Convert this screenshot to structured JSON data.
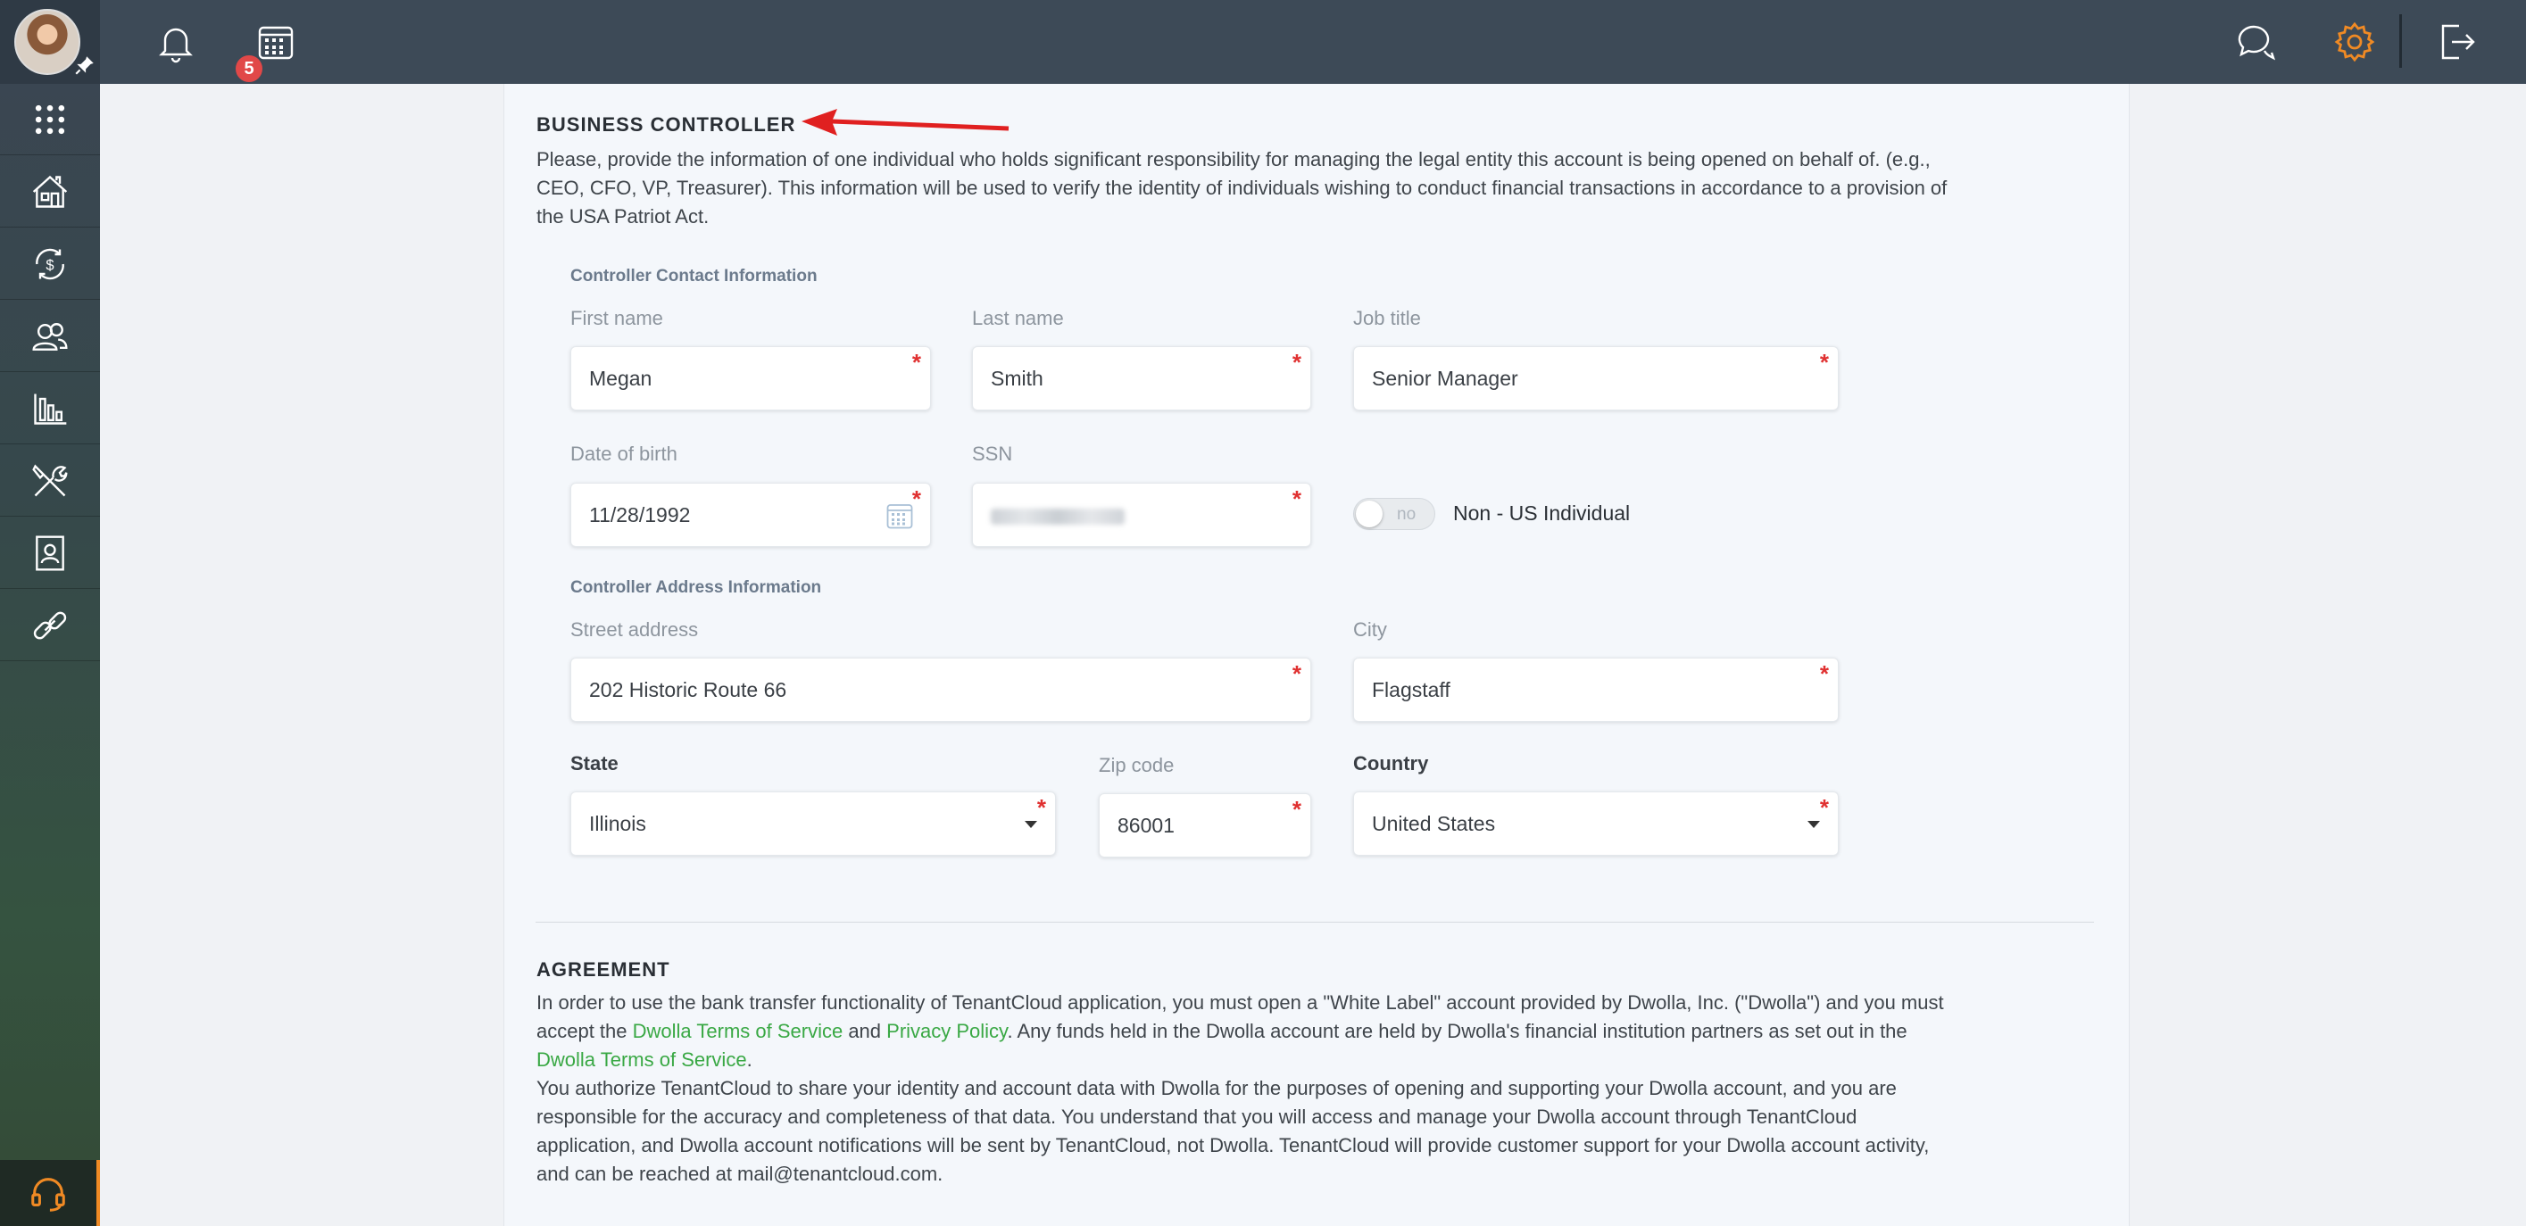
{
  "topbar": {
    "notification_count": "5",
    "icons": [
      "bell-icon",
      "calendar-icon",
      "chat-icon",
      "gear-icon",
      "logout-icon"
    ]
  },
  "sidebar": {
    "items": [
      {
        "icon": "apps-grid-icon"
      },
      {
        "icon": "properties-icon"
      },
      {
        "icon": "accounting-icon"
      },
      {
        "icon": "users-icon"
      },
      {
        "icon": "reports-icon"
      },
      {
        "icon": "maintenance-icon"
      },
      {
        "icon": "applicants-icon"
      },
      {
        "icon": "link-icon"
      }
    ],
    "support_icon": "headset-icon"
  },
  "business_controller": {
    "title": "BUSINESS CONTROLLER",
    "description": [
      "Please, provide the information of one individual who holds significant responsibility for managing the legal entity this account is being opened on behalf of. (e.g.,",
      "CEO, CFO, VP, Treasurer). This information will be used to verify the identity of individuals wishing to conduct financial transactions in accordance to a provision of",
      "the USA Patriot Act."
    ],
    "contact_heading": "Controller Contact Information",
    "first_name": {
      "label": "First name",
      "value": "Megan"
    },
    "last_name": {
      "label": "Last name",
      "value": "Smith"
    },
    "job_title": {
      "label": "Job title",
      "value": "Senior Manager"
    },
    "dob": {
      "label": "Date of birth",
      "value": "11/28/1992"
    },
    "ssn": {
      "label": "SSN"
    },
    "non_us": {
      "toggle_text": "no",
      "label": "Non - US Individual"
    },
    "address_heading": "Controller Address Information",
    "street": {
      "label": "Street address",
      "value": "202 Historic Route 66"
    },
    "city": {
      "label": "City",
      "value": "Flagstaff"
    },
    "state": {
      "label": "State",
      "value": "Illinois"
    },
    "zip": {
      "label": "Zip code",
      "value": "86001"
    },
    "country": {
      "label": "Country",
      "value": "United States"
    }
  },
  "agreement": {
    "title": "AGREEMENT",
    "p1_a": "In order to use the bank transfer functionality of TenantCloud application, you must open a \"White Label\" account provided by Dwolla, Inc. (\"Dwolla\") and you must",
    "p1_b": "accept the ",
    "link_terms": "Dwolla Terms of Service",
    "p1_c": " and ",
    "link_privacy": "Privacy Policy",
    "p1_d": ". Any funds held in the Dwolla account are held by Dwolla's financial institution partners as set out in the",
    "link_terms_2": "Dwolla Terms of Service",
    "p1_e": ".",
    "p2": [
      "You authorize TenantCloud to share your identity and account data with Dwolla for the purposes of opening and supporting your Dwolla account, and you are",
      "responsible for the accuracy and completeness of that data. You understand that you will access and manage your Dwolla account through TenantCloud",
      "application, and Dwolla account notifications will be sent by TenantCloud, not Dwolla. TenantCloud will provide customer support for your Dwolla account activity,",
      "and can be reached at mail@tenantcloud.com."
    ]
  },
  "colors": {
    "topbar": "#3d4a57",
    "accent_orange": "#f08a24",
    "link_green": "#39a844",
    "required_red": "#e03131",
    "annotation_arrow": "#e02020"
  }
}
